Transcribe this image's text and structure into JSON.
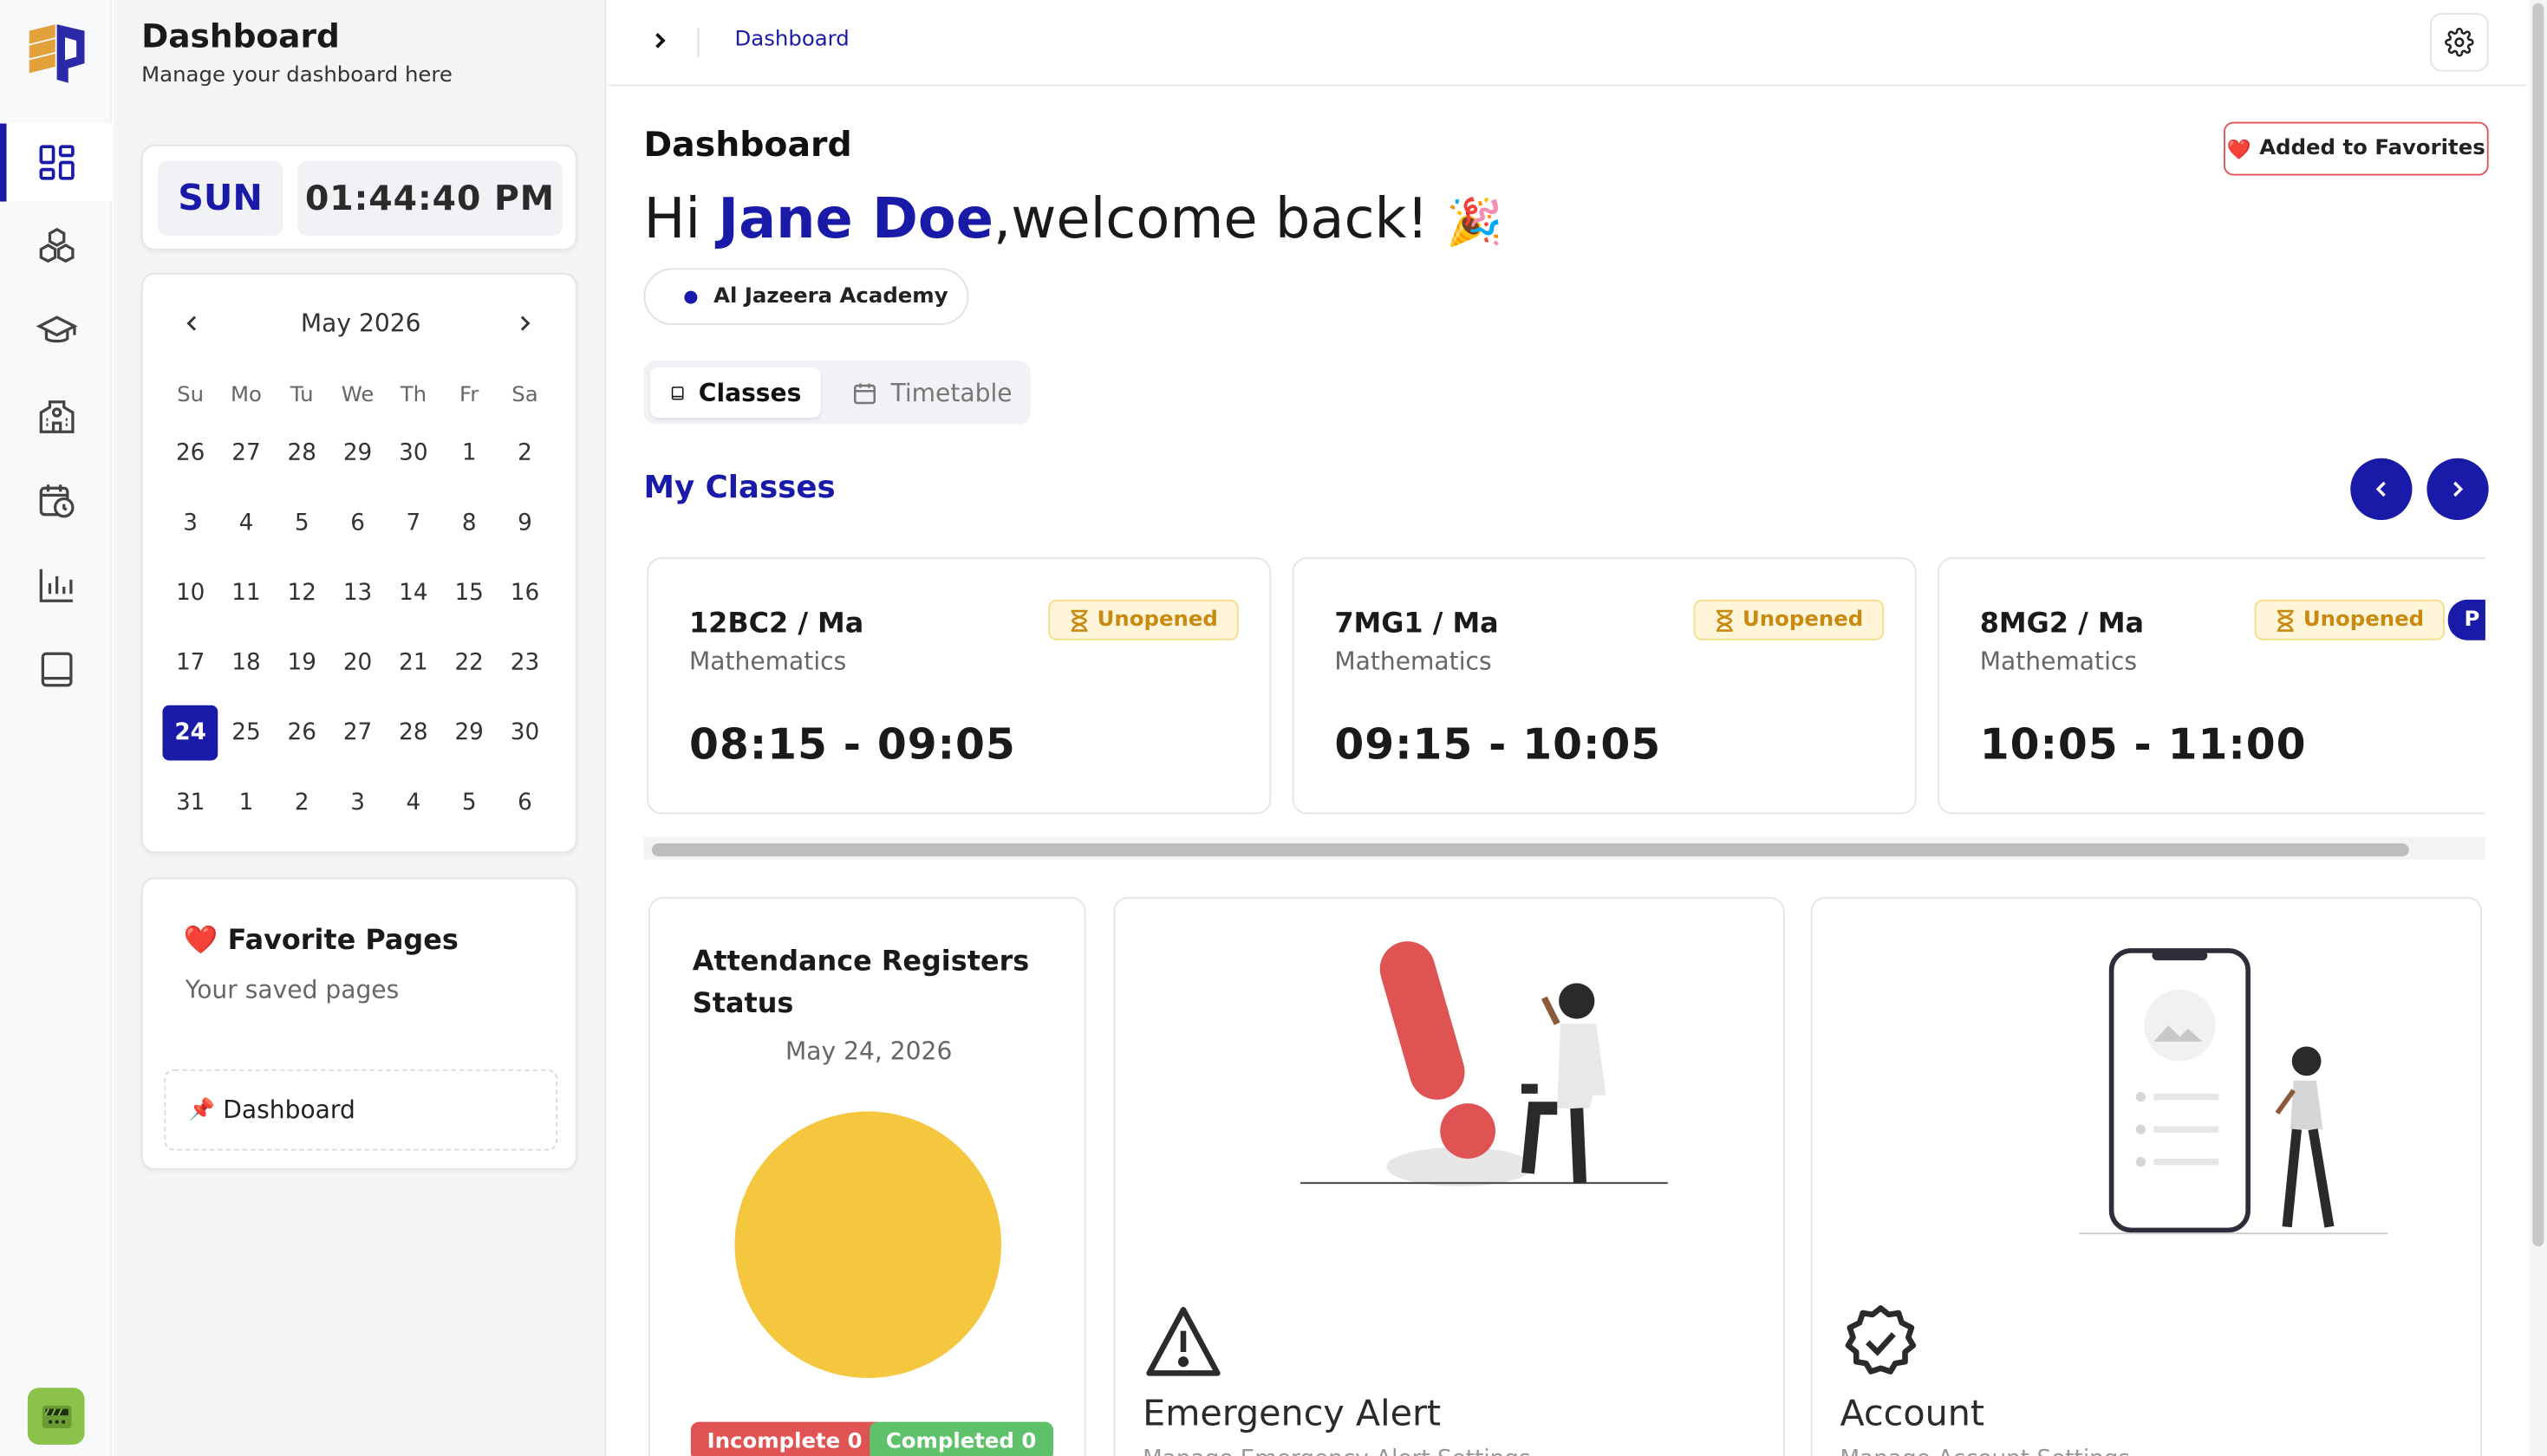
{
  "sidebar": {
    "items": [
      {
        "icon": "dashboard-icon",
        "active": true
      },
      {
        "icon": "modules-icon"
      },
      {
        "icon": "graduation-cap-icon"
      },
      {
        "icon": "school-building-icon"
      },
      {
        "icon": "schedule-icon"
      },
      {
        "icon": "chart-icon"
      },
      {
        "icon": "book-icon"
      }
    ]
  },
  "left_panel": {
    "title": "Dashboard",
    "subtitle": "Manage your dashboard here",
    "clock": {
      "day": "SUN",
      "time": "01:44:40 PM"
    },
    "calendar": {
      "month": "May 2026",
      "weekdays": [
        "Su",
        "Mo",
        "Tu",
        "We",
        "Th",
        "Fr",
        "Sa"
      ],
      "weeks": [
        [
          "26",
          "27",
          "28",
          "29",
          "30",
          "1",
          "2"
        ],
        [
          "3",
          "4",
          "5",
          "6",
          "7",
          "8",
          "9"
        ],
        [
          "10",
          "11",
          "12",
          "13",
          "14",
          "15",
          "16"
        ],
        [
          "17",
          "18",
          "19",
          "20",
          "21",
          "22",
          "23"
        ],
        [
          "24",
          "25",
          "26",
          "27",
          "28",
          "29",
          "30"
        ],
        [
          "31",
          "1",
          "2",
          "3",
          "4",
          "5",
          "6"
        ]
      ],
      "selected": "24"
    },
    "favorites": {
      "title": "Favorite Pages",
      "subtitle": "Your saved pages",
      "items": [
        "Dashboard"
      ]
    }
  },
  "topbar": {
    "breadcrumb": "Dashboard"
  },
  "main": {
    "title": "Dashboard",
    "favorite_button": "Added to Favorites",
    "greeting_prefix": "Hi ",
    "user_name": "Jane Doe",
    "greeting_suffix": ",welcome back! ",
    "greeting_emoji": "🎉",
    "school": "Al Jazeera Academy",
    "tabs": [
      {
        "label": "Classes",
        "active": true
      },
      {
        "label": "Timetable",
        "active": false
      }
    ],
    "section_title": "My Classes",
    "classes": [
      {
        "code": "12BC2 / Ma",
        "subject": "Mathematics",
        "time": "08:15 - 09:05",
        "status": "Unopened"
      },
      {
        "code": "7MG1 / Ma",
        "subject": "Mathematics",
        "time": "09:15 - 10:05",
        "status": "Unopened"
      },
      {
        "code": "8MG2 / Ma",
        "subject": "Mathematics",
        "time": "10:05 - 11:00",
        "status": "Unopened",
        "extra_badge": "P"
      }
    ],
    "attendance": {
      "title": "Attendance Registers Status",
      "date": "May 24, 2026",
      "incomplete_label": "Incomplete 0",
      "completed_label": "Completed 0",
      "incomplete": 0,
      "completed": 0
    },
    "features": [
      {
        "title": "Emergency Alert",
        "subtitle": "Manage Emergency Alert Settings",
        "icon": "warning-icon"
      },
      {
        "title": "Account",
        "subtitle": "Manage Account Settings",
        "icon": "badge-check-icon"
      }
    ]
  },
  "colors": {
    "accent": "#1a1aa8",
    "warning_bg": "#fff6d9",
    "warning_text": "#c98a12",
    "danger": "#e05353",
    "success": "#5fc26a",
    "pie": "#f4c73f"
  }
}
